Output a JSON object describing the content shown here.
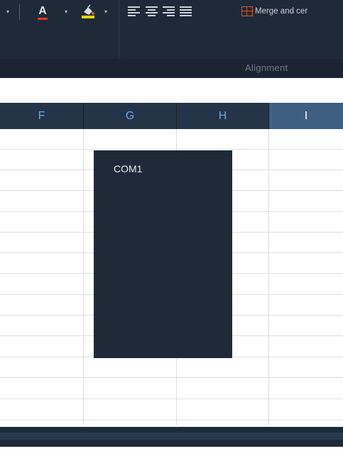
{
  "ribbon": {
    "group_label": "Alignment",
    "merge_label": "Merge and cer",
    "font_color_accent": "#e23c2a",
    "highlight_accent": "#f5d000",
    "merge_icon_color": "#d45a2a"
  },
  "columns": [
    "F",
    "G",
    "H",
    "I"
  ],
  "selected_column": "I",
  "dropdown": {
    "items": [
      "COM1"
    ]
  },
  "colors": {
    "ribbon_bg": "#1f2a38",
    "header_bg": "#243449",
    "header_text": "#6aa7e0",
    "header_selected_bg": "#3f5f80"
  }
}
